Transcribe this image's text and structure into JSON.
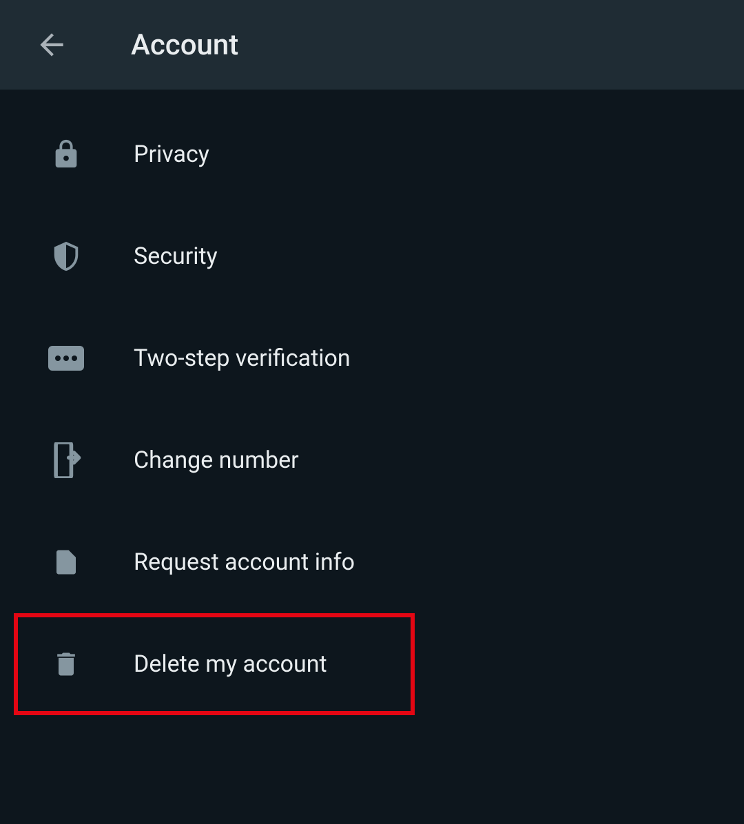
{
  "header": {
    "title": "Account"
  },
  "menu": {
    "items": [
      {
        "label": "Privacy",
        "icon": "lock-icon"
      },
      {
        "label": "Security",
        "icon": "shield-icon"
      },
      {
        "label": "Two-step verification",
        "icon": "pin-icon"
      },
      {
        "label": "Change number",
        "icon": "change-number-icon"
      },
      {
        "label": "Request account info",
        "icon": "document-icon"
      },
      {
        "label": "Delete my account",
        "icon": "trash-icon"
      }
    ]
  },
  "highlighted_index": 5
}
